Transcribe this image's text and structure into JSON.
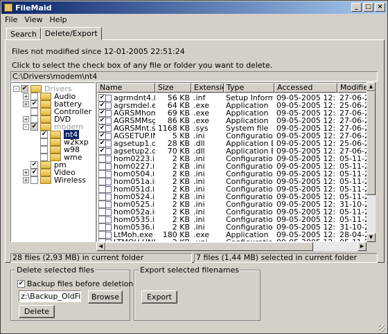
{
  "window": {
    "title": "FileMaid"
  },
  "menu": [
    "File",
    "View",
    "Help"
  ],
  "tabs": [
    "Search",
    "Delete/Export"
  ],
  "info_line1": "Files not modified since 12-01-2005 22:51:24",
  "info_line2": "Click to select the check box of any file or folder you want to delete.",
  "path": "C:\\Drivers\\modem\\nt4",
  "tree": [
    {
      "label": "Drivers",
      "exp": "-",
      "check": "✔",
      "gray": true,
      "dim": true,
      "level": 0
    },
    {
      "label": "Audio",
      "exp": "+",
      "check": "",
      "gray": false,
      "dim": false,
      "level": 1
    },
    {
      "label": "battery",
      "exp": "+",
      "check": "✔",
      "gray": false,
      "dim": false,
      "level": 1
    },
    {
      "label": "Controller",
      "exp": "",
      "check": "",
      "gray": false,
      "dim": false,
      "level": 1
    },
    {
      "label": "DVD",
      "exp": "+",
      "check": "",
      "gray": false,
      "dim": false,
      "level": 1
    },
    {
      "label": "modem",
      "exp": "-",
      "check": "✔",
      "gray": true,
      "dim": true,
      "level": 1
    },
    {
      "label": "nt4",
      "exp": "",
      "check": "✔",
      "gray": false,
      "dim": false,
      "level": 2,
      "selected": true
    },
    {
      "label": "w2kxp",
      "exp": "",
      "check": "",
      "gray": false,
      "dim": false,
      "level": 2
    },
    {
      "label": "w98",
      "exp": "",
      "check": "",
      "gray": false,
      "dim": false,
      "level": 2
    },
    {
      "label": "wme",
      "exp": "",
      "check": "",
      "gray": false,
      "dim": false,
      "level": 2
    },
    {
      "label": "pm",
      "exp": "",
      "check": "✔",
      "gray": false,
      "dim": false,
      "level": 1
    },
    {
      "label": "Video",
      "exp": "+",
      "check": "✔",
      "gray": false,
      "dim": false,
      "level": 1
    },
    {
      "label": "Wireless",
      "exp": "+",
      "check": "",
      "gray": false,
      "dim": false,
      "level": 1
    }
  ],
  "columns": [
    "Name",
    "Size",
    "Extension",
    "Type",
    "Accessed",
    "Modified"
  ],
  "files": [
    {
      "checked": true,
      "name": "agrmdnt4.inf",
      "size": "56 KB",
      "ext": ".inf",
      "type": "Setup Informati...",
      "accessed": "09-05-2005 12:56:05",
      "modified": "27-06-2001"
    },
    {
      "checked": true,
      "name": "agrsmdel.exe",
      "size": "64 KB",
      "ext": ".exe",
      "type": "Application",
      "accessed": "09-05-2005 12:56:05",
      "modified": "25-06-2001"
    },
    {
      "checked": true,
      "name": "AGRSMhom...",
      "size": "69 KB",
      "ext": ".exe",
      "type": "Application",
      "accessed": "09-05-2005 12:56:05",
      "modified": "27-06-2001"
    },
    {
      "checked": true,
      "name": "AGRSMMsg...",
      "size": "86 KB",
      "ext": ".exe",
      "type": "Application",
      "accessed": "09-05-2005 12:56:05",
      "modified": "27-06-2001"
    },
    {
      "checked": true,
      "name": "AGRSMnt.sys",
      "size": "1168 KB",
      "ext": ".sys",
      "type": "System file",
      "accessed": "09-05-2005 12:56:05",
      "modified": "27-06-2001"
    },
    {
      "checked": true,
      "name": "AGSETUP.INI",
      "size": "5 KB",
      "ext": ".ini",
      "type": "Configuration S...",
      "accessed": "09-05-2005 12:56:05",
      "modified": "27-06-2001"
    },
    {
      "checked": true,
      "name": "agsetup1.dll",
      "size": "28 KB",
      "ext": ".dll",
      "type": "Application Ext...",
      "accessed": "09-05-2005 12:56:05",
      "modified": "25-06-2001"
    },
    {
      "checked": true,
      "name": "agsetup2.dll",
      "size": "70 KB",
      "ext": ".dll",
      "type": "Application Ext...",
      "accessed": "09-05-2005 12:56:59",
      "modified": "27-06-2001"
    },
    {
      "checked": false,
      "name": "hom0223.ini",
      "size": "2 KB",
      "ext": ".ini",
      "type": "Configuration S...",
      "accessed": "09-05-2005 12:56:59",
      "modified": "05-11-2001"
    },
    {
      "checked": false,
      "name": "hom0227.ini",
      "size": "2 KB",
      "ext": ".ini",
      "type": "Configuration S...",
      "accessed": "09-05-2005 12:56:59",
      "modified": "05-11-2001"
    },
    {
      "checked": false,
      "name": "hom0504.ini",
      "size": "2 KB",
      "ext": ".ini",
      "type": "Configuration S...",
      "accessed": "09-05-2005 12:56:59",
      "modified": "05-11-2001"
    },
    {
      "checked": false,
      "name": "hom051a.ini",
      "size": "2 KB",
      "ext": ".ini",
      "type": "Configuration S...",
      "accessed": "09-05-2005 12:56:59",
      "modified": "05-11-2001"
    },
    {
      "checked": false,
      "name": "hom051d.ini",
      "size": "2 KB",
      "ext": ".ini",
      "type": "Configuration S...",
      "accessed": "09-05-2005 12:56:59",
      "modified": "05-11-2001"
    },
    {
      "checked": false,
      "name": "hom0524.ini",
      "size": "2 KB",
      "ext": ".ini",
      "type": "Configuration S...",
      "accessed": "09-05-2005 12:56:59",
      "modified": "05-11-2001"
    },
    {
      "checked": false,
      "name": "hom0525.ini",
      "size": "2 KB",
      "ext": ".ini",
      "type": "Configuration S...",
      "accessed": "09-05-2005 12:56:59",
      "modified": "31-10-2001"
    },
    {
      "checked": false,
      "name": "hom052a.ini",
      "size": "2 KB",
      "ext": ".ini",
      "type": "Configuration S...",
      "accessed": "09-05-2005 12:56:59",
      "modified": "05-11-2001"
    },
    {
      "checked": false,
      "name": "hom0535.ini",
      "size": "2 KB",
      "ext": ".ini",
      "type": "Configuration S...",
      "accessed": "09-05-2005 12:56:59",
      "modified": "05-11-2001"
    },
    {
      "checked": false,
      "name": "hom0536.ini",
      "size": "2 KB",
      "ext": ".ini",
      "type": "Configuration S...",
      "accessed": "09-05-2005 12:56:59",
      "modified": "31-10-2001"
    },
    {
      "checked": false,
      "name": "LtMoh.exe",
      "size": "180 KB",
      "ext": ".exe",
      "type": "Application",
      "accessed": "09-05-2005 12:56:59",
      "modified": "28-04-2001"
    },
    {
      "checked": false,
      "name": "LTMOH.UNI",
      "size": "2 KB",
      "ext": ".uni",
      "type": "Configuration S...",
      "accessed": "09-05-2005 12:56:59",
      "modified": "05-11-2001"
    }
  ],
  "status_left": "28 files (2,93 MB) in current folder",
  "status_right": "7 files (1,44 MB) selected in current folder",
  "delete_group": {
    "title": "Delete selected files",
    "backup_label": "Backup files before deletion",
    "backup_checked": true,
    "backup_path": "z:\\Backup_OldFiles",
    "browse": "Browse",
    "delete": "Delete"
  },
  "export_group": {
    "title": "Export selected filenames",
    "export": "Export"
  },
  "colors": {
    "title_start": "#0a246a",
    "title_end": "#a6caf0",
    "selection": "#0a246a",
    "face": "#d4d0c8"
  }
}
